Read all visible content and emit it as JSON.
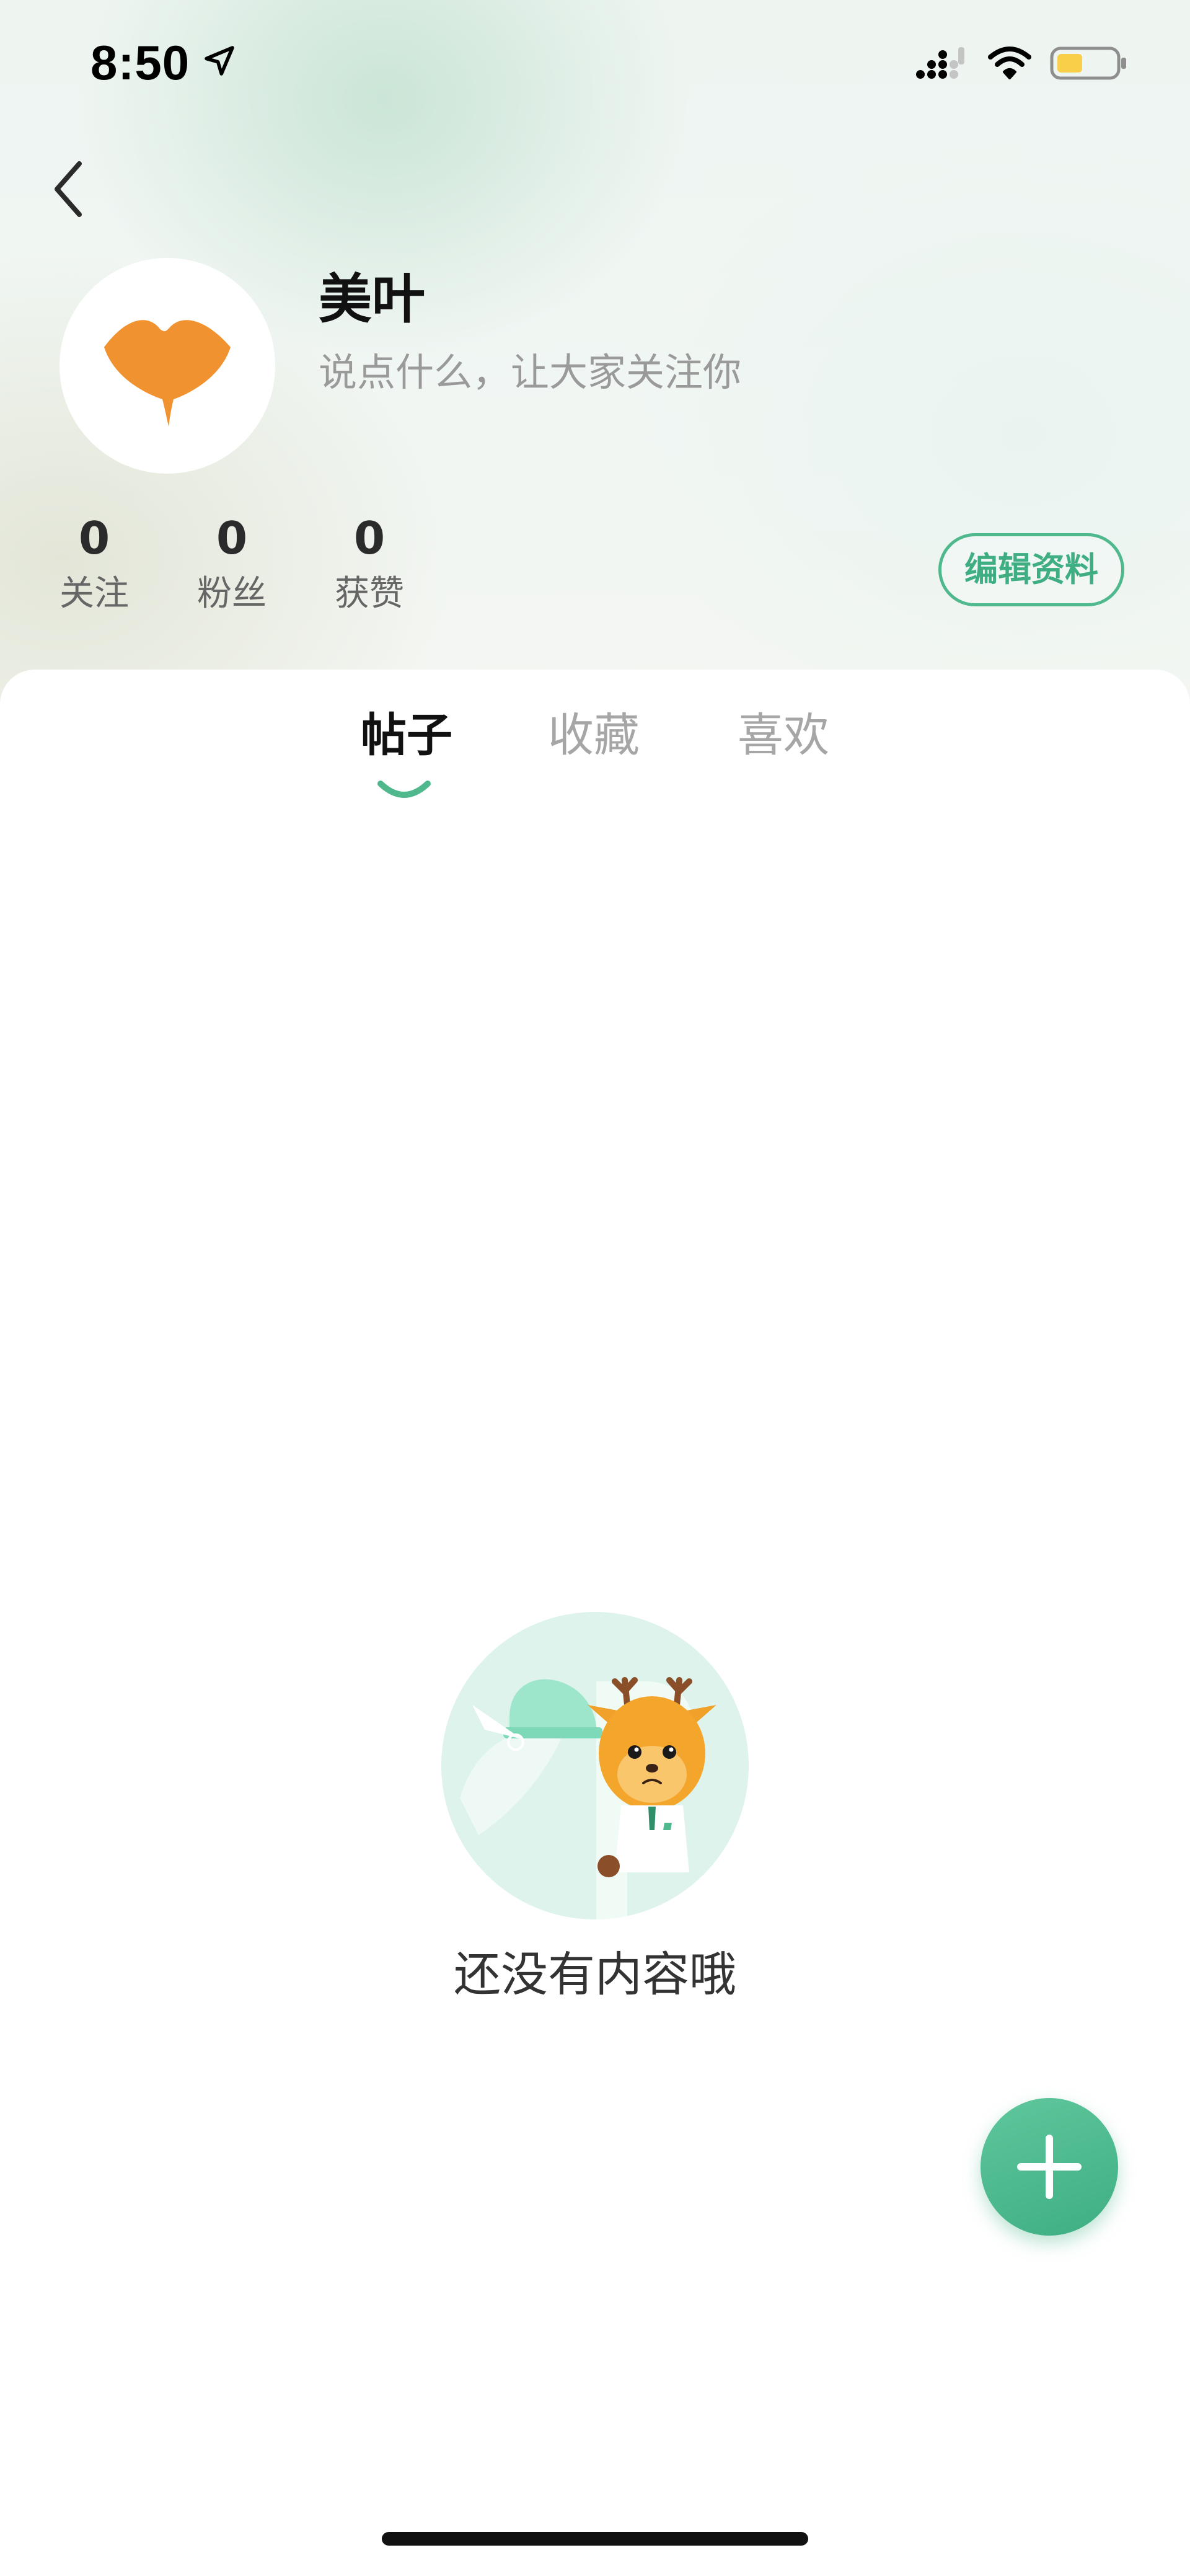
{
  "status_bar": {
    "time": "8:50",
    "icons": [
      "location-arrow-icon",
      "cellular-signal-icon",
      "wifi-icon",
      "battery-icon"
    ]
  },
  "header": {
    "back_icon": "chevron-left-icon"
  },
  "profile": {
    "avatar_icon": "ginkgo-leaf-icon",
    "name": "美叶",
    "bio_placeholder": "说点什么，让大家关注你",
    "stats": [
      {
        "value": "0",
        "label": "关注"
      },
      {
        "value": "0",
        "label": "粉丝"
      },
      {
        "value": "0",
        "label": "获赞"
      }
    ],
    "edit_button_label": "编辑资料"
  },
  "tabs": {
    "items": [
      {
        "label": "帖子",
        "active": true
      },
      {
        "label": "收藏",
        "active": false
      },
      {
        "label": "喜欢",
        "active": false
      }
    ]
  },
  "empty_state": {
    "illustration": "deer-mascot-illustration",
    "message": "还没有内容哦"
  },
  "fab": {
    "icon": "plus-icon"
  },
  "colors": {
    "accent": "#4fb88d",
    "avatar_orange": "#f0922f",
    "battery_yellow": "#f7cf48"
  }
}
